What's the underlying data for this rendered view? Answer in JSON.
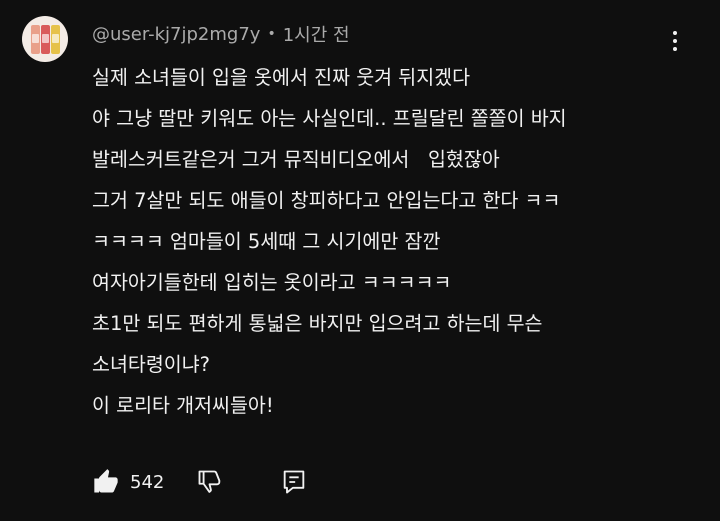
{
  "comment": {
    "author": "@user-kj7jp2mg7y",
    "separator": "•",
    "timestamp": "1시간 전",
    "lines": [
      "실제 소녀들이 입을 옷에서 진짜 웃겨 뒤지겠다",
      "야 그냥 딸만 키워도 아는 사실인데.. 프릴달린 쫄쫄이 바지",
      "발레스커트같은거 그거 뮤직비디오에서   입혔잖아",
      "그거 7살만 되도 애들이 창피하다고 안입는다고 한다 ㅋㅋ",
      "ㅋㅋㅋㅋ 엄마들이 5세때 그 시기에만 잠깐",
      "여자아기들한테 입히는 옷이라고 ㅋㅋㅋㅋㅋ",
      "초1만 되도 편하게 통넓은 바지만 입으려고 하는데 무슨",
      "소녀타령이냐?",
      "이 로리타 개저씨들아!"
    ],
    "like_count": "542"
  },
  "icons": {
    "avatar": "avatar-image",
    "menu": "more-vert-icon",
    "like": "thumbs-up-icon",
    "dislike": "thumbs-down-icon",
    "reply": "reply-icon"
  },
  "colors": {
    "background": "#0f0f0f",
    "text": "#f1f1f1",
    "secondary_text": "#aaaaaa"
  }
}
